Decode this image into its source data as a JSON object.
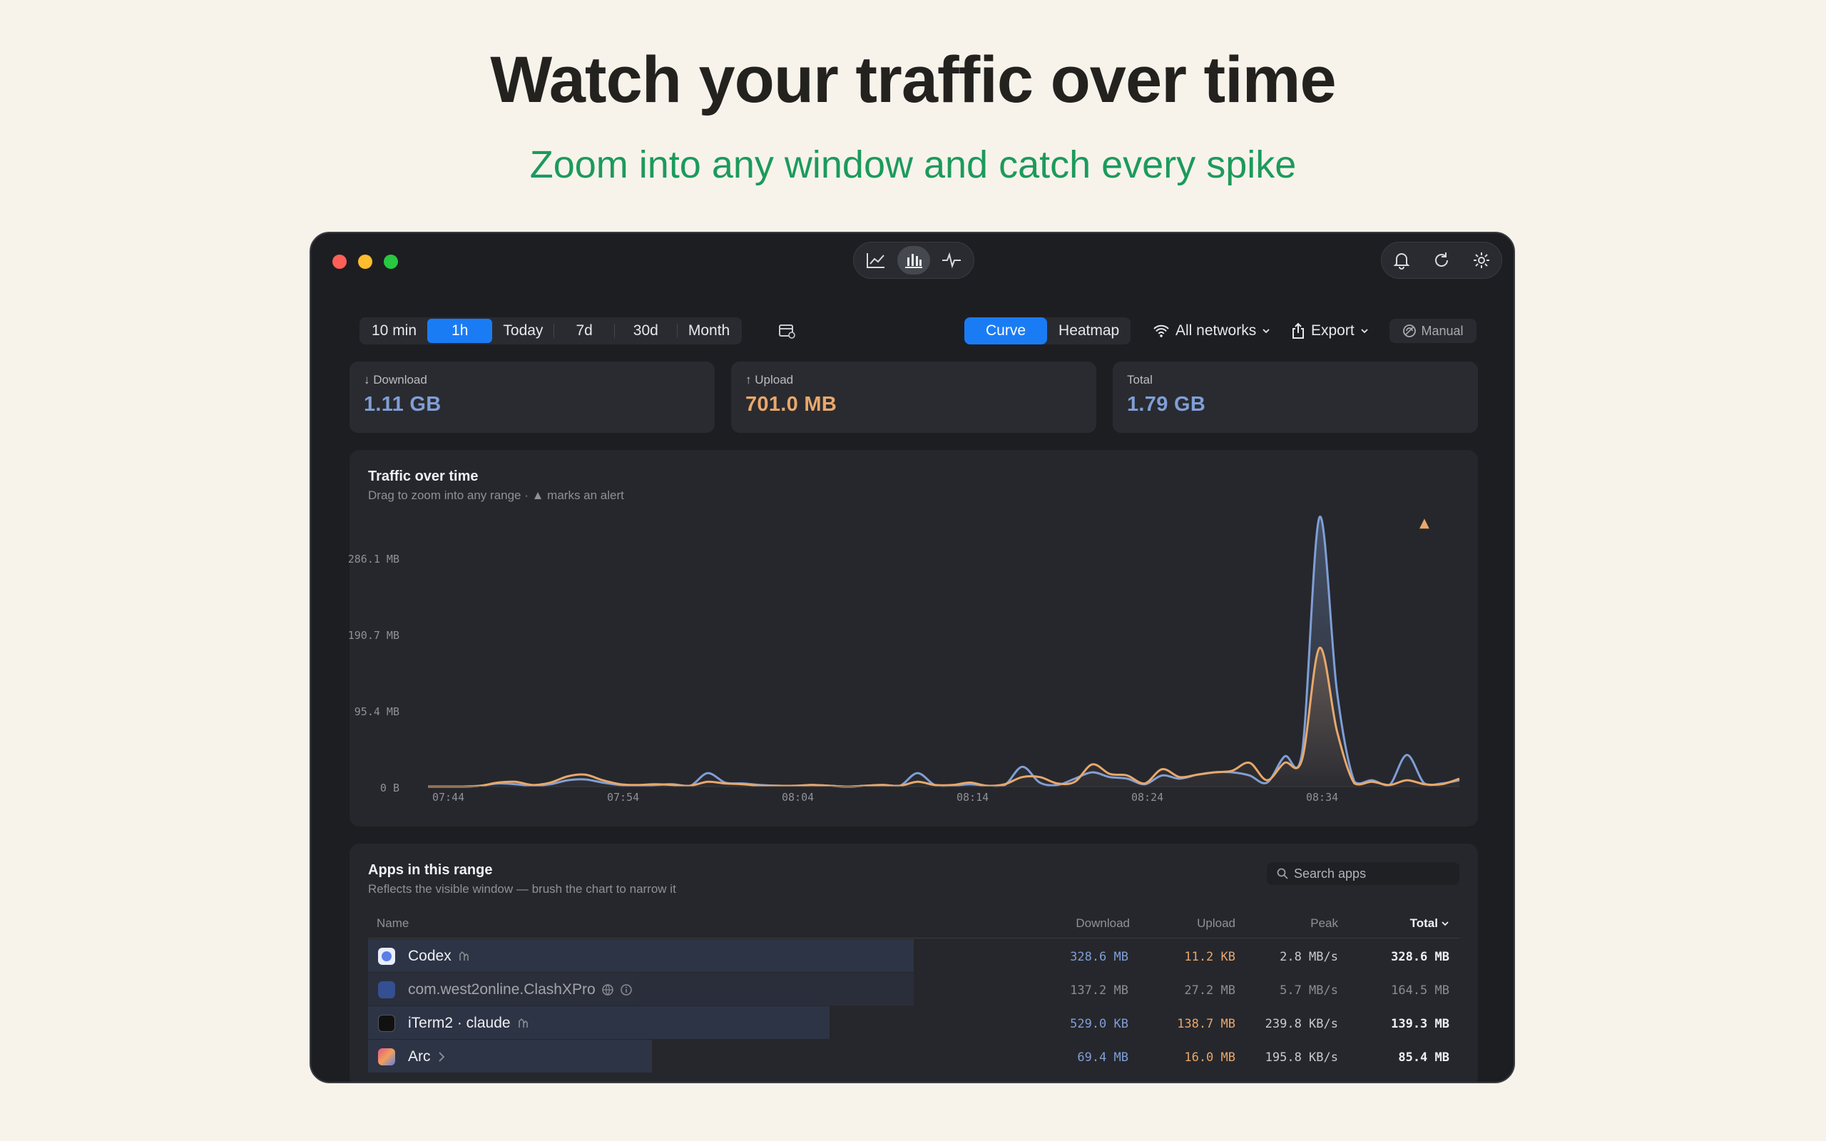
{
  "hero": {
    "title": "Watch your traffic over time",
    "subtitle": "Zoom into any window and catch every spike"
  },
  "window": {
    "traffic_lights": [
      "#ff5f57",
      "#febc2e",
      "#28c840"
    ],
    "view_switcher": {
      "selected": "bar-chart-icon",
      "icons": [
        "line-chart-icon",
        "bar-chart-icon",
        "pulse-icon"
      ]
    },
    "toolbar_icons": [
      "bell-icon",
      "refresh-icon",
      "gear-icon"
    ]
  },
  "ranges": {
    "options": [
      "10 min",
      "1h",
      "Today",
      "7d",
      "30d",
      "Month"
    ],
    "selected": "1h"
  },
  "display_mode": {
    "options": [
      "Curve",
      "Heatmap"
    ],
    "selected": "Curve"
  },
  "network_filter": "All networks",
  "export_label": "Export",
  "manual_label": "Manual",
  "stats": {
    "download": {
      "label": "Download",
      "value": "1.11 GB",
      "color": "#7f9fd6"
    },
    "upload": {
      "label": "Upload",
      "value": "701.0 MB",
      "color": "#e8a86b"
    },
    "total": {
      "label": "Total",
      "value": "1.79 GB",
      "color": "#7f9fd6"
    }
  },
  "chart": {
    "title": "Traffic over time",
    "subtitle": "Drag to zoom into any range · ▲ marks an alert"
  },
  "chart_data": {
    "type": "area",
    "title": "Traffic over time",
    "y_unit": "MB",
    "ylim": [
      0,
      360
    ],
    "y_ticks": [
      "0 B",
      "95.4 MB",
      "190.7 MB",
      "286.1 MB"
    ],
    "x_ticks": [
      "07:44",
      "07:54",
      "08:04",
      "08:14",
      "08:24",
      "08:34"
    ],
    "x_minutes": [
      0,
      1,
      2,
      3,
      4,
      5,
      6,
      7,
      8,
      9,
      10,
      11,
      12,
      13,
      14,
      15,
      16,
      17,
      18,
      19,
      20,
      21,
      22,
      23,
      24,
      25,
      26,
      27,
      28,
      29,
      30,
      31,
      32,
      33,
      34,
      35,
      36,
      37,
      38,
      39,
      40,
      41,
      42,
      43,
      44,
      45,
      46,
      47,
      48,
      49,
      50,
      51,
      52,
      53,
      54,
      55,
      56,
      57,
      58,
      59
    ],
    "series": [
      {
        "name": "Download",
        "color": "#7f9fd6",
        "values": [
          0,
          0,
          0,
          1,
          4,
          3,
          1,
          3,
          8,
          9,
          5,
          2,
          1,
          2,
          3,
          1,
          17,
          5,
          4,
          2,
          1,
          1,
          2,
          1,
          0,
          1,
          2,
          1,
          17,
          2,
          1,
          3,
          1,
          2,
          25,
          5,
          2,
          10,
          18,
          12,
          10,
          3,
          14,
          10,
          15,
          18,
          18,
          14,
          5,
          38,
          42,
          340,
          120,
          6,
          8,
          2,
          40,
          4,
          4,
          8
        ]
      },
      {
        "name": "Upload",
        "color": "#e8a86b",
        "values": [
          0,
          0,
          0,
          1,
          5,
          6,
          2,
          5,
          13,
          15,
          8,
          3,
          2,
          3,
          2,
          1,
          6,
          4,
          3,
          1,
          1,
          1,
          2,
          1,
          0,
          1,
          2,
          1,
          6,
          2,
          2,
          5,
          1,
          3,
          12,
          12,
          4,
          6,
          28,
          16,
          14,
          4,
          22,
          12,
          15,
          18,
          20,
          30,
          8,
          30,
          34,
          175,
          70,
          4,
          6,
          2,
          8,
          3,
          3,
          10
        ]
      }
    ],
    "alerts": [
      {
        "x_minute": 57,
        "label": "▲"
      }
    ],
    "grid": false,
    "legend": "none"
  },
  "apps": {
    "title": "Apps in this range",
    "subtitle": "Reflects the visible window — brush the chart to narrow it",
    "search_placeholder": "Search apps",
    "columns": {
      "name": "Name",
      "download": "Download",
      "upload": "Upload",
      "peak": "Peak",
      "total": "Total"
    },
    "sort": {
      "column": "Total",
      "direction": "descending"
    },
    "rows": [
      {
        "name": "Codex",
        "badge": "group-icon",
        "download": "328.6 MB",
        "upload": "11.2 KB",
        "peak": "2.8 MB/s",
        "total": "328.6 MB",
        "share": 0.5,
        "icon_color": "#5b7fe8"
      },
      {
        "name": "com.west2online.ClashXPro",
        "badge": "globe-icon",
        "extra": "info-icon",
        "download": "137.2 MB",
        "upload": "27.2 MB",
        "peak": "5.7 MB/s",
        "total": "164.5 MB",
        "share": 0.5,
        "icon_color": "#3d6ad1",
        "dim": true
      },
      {
        "name": "iTerm2 · claude",
        "badge": "group-icon",
        "download": "529.0 KB",
        "upload": "138.7 MB",
        "peak": "239.8 KB/s",
        "total": "139.3 MB",
        "share": 0.423,
        "icon_color": "#1a1a1a"
      },
      {
        "name": "Arc",
        "badge": "chevron-right-icon",
        "download": "69.4 MB",
        "upload": "16.0 MB",
        "peak": "195.8 KB/s",
        "total": "85.4 MB",
        "share": 0.26,
        "icon_color": "#e0568a"
      }
    ]
  }
}
